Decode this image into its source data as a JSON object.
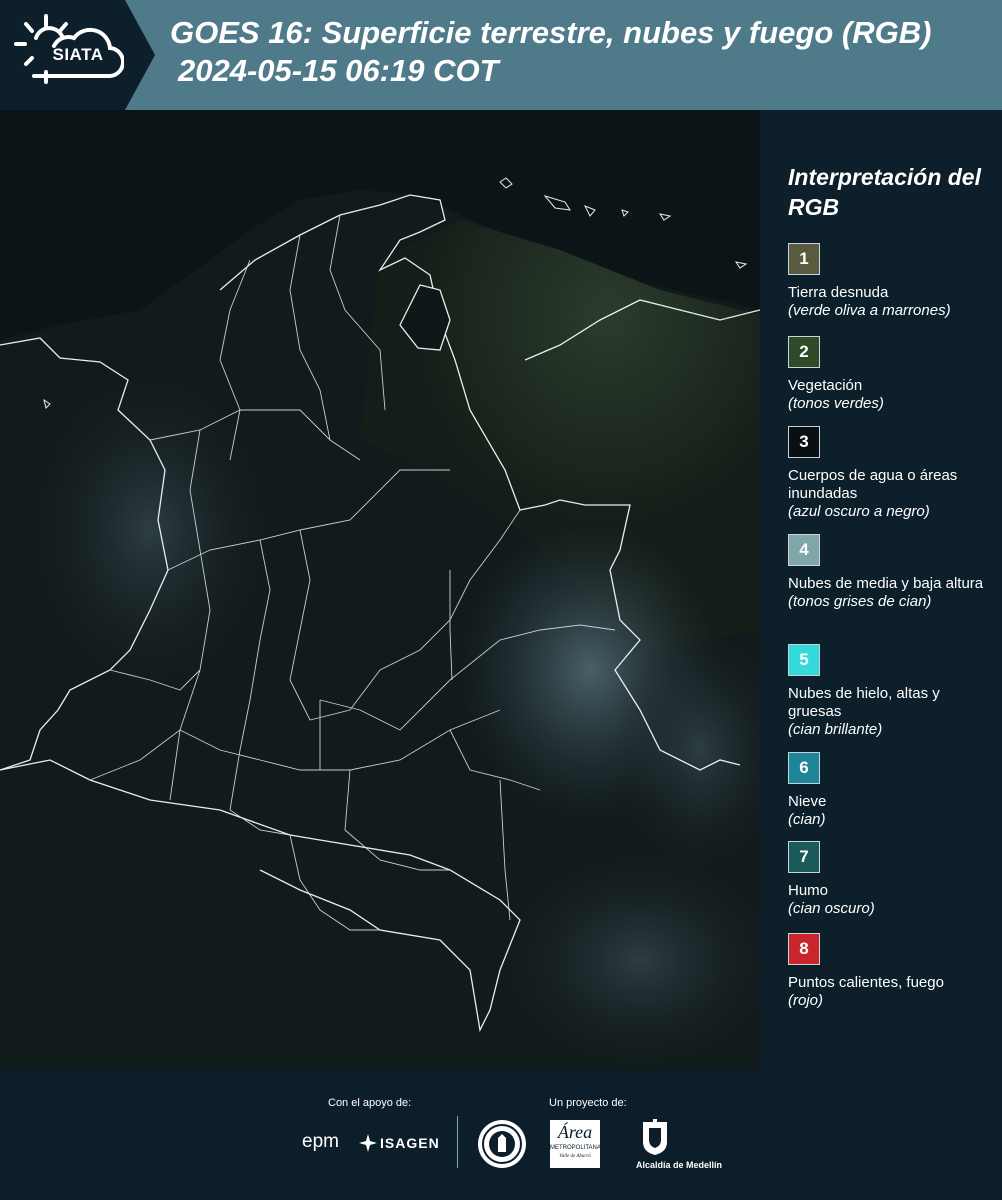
{
  "header": {
    "logo_text": "SIATA",
    "title_line1": "GOES 16: Superficie terrestre, nubes y fuego (RGB)",
    "title_line2": "2024-05-15 06:19 COT",
    "bar_color": "#4f7a8a"
  },
  "legend": {
    "title": "Interpretación del RGB",
    "items": [
      {
        "number": "1",
        "label": "Tierra desnuda",
        "sublabel": "(verde oliva a marrones)",
        "color": "#5a5a3e"
      },
      {
        "number": "2",
        "label": "Vegetación",
        "sublabel": "(tonos verdes)",
        "color": "#2e4a26"
      },
      {
        "number": "3",
        "label": "Cuerpos de agua o áreas inundadas",
        "sublabel": "(azul oscuro a negro)",
        "color": "#0a0f14"
      },
      {
        "number": "4",
        "label": "Nubes de media y baja altura",
        "sublabel": "(tonos grises de cian)",
        "color": "#7fa7a8"
      },
      {
        "number": "5",
        "label": "Nubes de hielo, altas y gruesas",
        "sublabel": "(cian brillante)",
        "color": "#33d9db"
      },
      {
        "number": "6",
        "label": "Nieve",
        "sublabel": "(cian)",
        "color": "#1f869a"
      },
      {
        "number": "7",
        "label": "Humo",
        "sublabel": "(cian oscuro)",
        "color": "#1a5a5a"
      },
      {
        "number": "8",
        "label": "Puntos calientes, fuego",
        "sublabel": "(rojo)",
        "color": "#c8262a"
      }
    ]
  },
  "footer": {
    "support_label": "Con el apoyo de:",
    "project_label": "Un proyecto de:",
    "sponsor_epm": "epm",
    "sponsor_isagen": "ISAGEN",
    "area_name": "Área",
    "area_subtitle": "METROPOLITANA",
    "area_tagline": "Valle de Aburrá",
    "medellin_label": "Alcaldía de Medellín"
  }
}
